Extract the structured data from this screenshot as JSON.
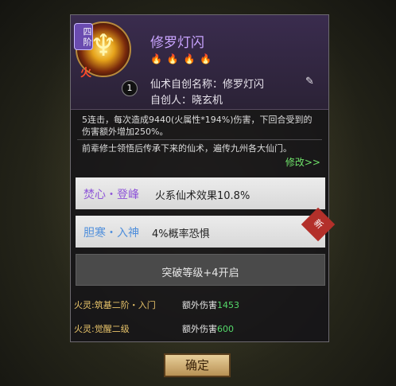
{
  "skill": {
    "tier": "四阶",
    "element": "火",
    "level": "1",
    "name": "修罗灯闪",
    "flames": [
      "on",
      "off",
      "off",
      "off"
    ],
    "creator_name_label": "仙术自创名称：",
    "creator_name_value": "修罗灯闪",
    "creator_label": "自创人：",
    "creator_value": "晓玄机"
  },
  "description": "5连击，每次造成9440(火属性*194%)伤害，下回合受到的伤害额外增加250%。",
  "lore": "前辈修士领悟后传承下来的仙术，遍传九州各大仙门。",
  "edit_label": "修改>>",
  "enhancements": [
    {
      "title": "焚心・登峰",
      "effect": "火系仙术效果10.8%"
    },
    {
      "title": "胆寒・入神",
      "effect": "4%概率恐惧",
      "badge": "新"
    }
  ],
  "locked_text": "突破等级+4开启",
  "bonuses": [
    {
      "label": "火灵:筑基二阶・入门",
      "text": "额外伤害",
      "value": "1453"
    },
    {
      "label": "火灵:觉醒二级",
      "text": "额外伤害",
      "value": "600"
    }
  ],
  "confirm_label": "确定"
}
